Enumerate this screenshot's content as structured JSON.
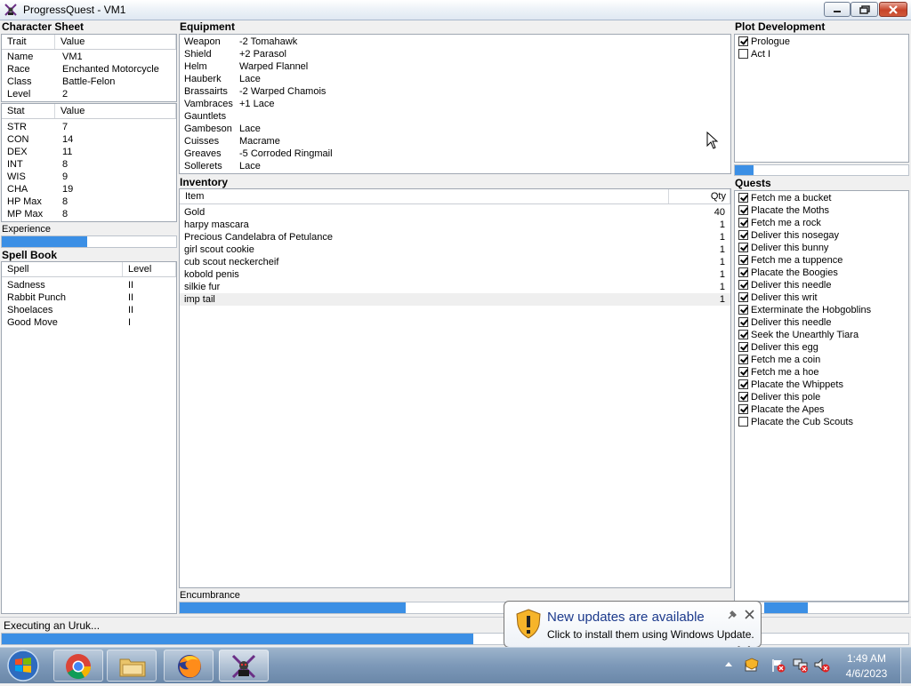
{
  "window": {
    "title": "ProgressQuest - VM1"
  },
  "character_sheet": {
    "title": "Character Sheet",
    "columns": [
      "Trait",
      "Value"
    ],
    "traits": [
      {
        "k": "Name",
        "v": "VM1"
      },
      {
        "k": "Race",
        "v": "Enchanted Motorcycle"
      },
      {
        "k": "Class",
        "v": "Battle-Felon"
      },
      {
        "k": "Level",
        "v": "2"
      }
    ],
    "stat_columns": [
      "Stat",
      "Value"
    ],
    "stats": [
      {
        "k": "STR",
        "v": "7"
      },
      {
        "k": "CON",
        "v": "14"
      },
      {
        "k": "DEX",
        "v": "11"
      },
      {
        "k": "INT",
        "v": "8"
      },
      {
        "k": "WIS",
        "v": "9"
      },
      {
        "k": "CHA",
        "v": "19"
      },
      {
        "k": "HP Max",
        "v": "8"
      },
      {
        "k": "MP Max",
        "v": "8"
      }
    ],
    "experience_label": "Experience",
    "experience_progress": 0.49
  },
  "spell_book": {
    "title": "Spell Book",
    "columns": [
      "Spell",
      "Level"
    ],
    "spells": [
      {
        "name": "Sadness",
        "level": "II"
      },
      {
        "name": "Rabbit Punch",
        "level": "II"
      },
      {
        "name": "Shoelaces",
        "level": "II"
      },
      {
        "name": "Good Move",
        "level": "I"
      }
    ]
  },
  "equipment": {
    "title": "Equipment",
    "items": [
      {
        "slot": "Weapon",
        "item": "-2 Tomahawk"
      },
      {
        "slot": "Shield",
        "item": "+2 Parasol"
      },
      {
        "slot": "Helm",
        "item": "Warped Flannel"
      },
      {
        "slot": "Hauberk",
        "item": "Lace"
      },
      {
        "slot": "Brassairts",
        "item": "-2 Warped Chamois"
      },
      {
        "slot": "Vambraces",
        "item": "+1 Lace"
      },
      {
        "slot": "Gauntlets",
        "item": ""
      },
      {
        "slot": "Gambeson",
        "item": "Lace"
      },
      {
        "slot": "Cuisses",
        "item": "Macrame"
      },
      {
        "slot": "Greaves",
        "item": "-5 Corroded Ringmail"
      },
      {
        "slot": "Sollerets",
        "item": "Lace"
      }
    ]
  },
  "inventory": {
    "title": "Inventory",
    "columns": [
      "Item",
      "Qty"
    ],
    "items": [
      {
        "name": "Gold",
        "qty": "40"
      },
      {
        "name": "harpy mascara",
        "qty": "1"
      },
      {
        "name": "Precious Candelabra of Petulance",
        "qty": "1"
      },
      {
        "name": "girl scout cookie",
        "qty": "1"
      },
      {
        "name": "cub scout neckercheif",
        "qty": "1"
      },
      {
        "name": "kobold penis",
        "qty": "1"
      },
      {
        "name": "silkie fur",
        "qty": "1"
      },
      {
        "name": "imp tail",
        "qty": "1"
      }
    ],
    "encumbrance_label": "Encumbrance",
    "encumbrance_progress": 0.41
  },
  "plot": {
    "title": "Plot Development",
    "acts": [
      {
        "label": "Prologue",
        "checked": true
      },
      {
        "label": "Act I",
        "checked": false
      }
    ],
    "progress": 0.11
  },
  "quests": {
    "title": "Quests",
    "items": [
      {
        "label": "Fetch me a bucket",
        "checked": true
      },
      {
        "label": "Placate the Moths",
        "checked": true
      },
      {
        "label": "Fetch me a rock",
        "checked": true
      },
      {
        "label": "Deliver this nosegay",
        "checked": true
      },
      {
        "label": "Deliver this bunny",
        "checked": true
      },
      {
        "label": "Fetch me a tuppence",
        "checked": true
      },
      {
        "label": "Placate the Boogies",
        "checked": true
      },
      {
        "label": "Deliver this needle",
        "checked": true
      },
      {
        "label": "Deliver this writ",
        "checked": true
      },
      {
        "label": "Exterminate the Hobgoblins",
        "checked": true
      },
      {
        "label": "Deliver this needle",
        "checked": true
      },
      {
        "label": "Seek the Unearthly Tiara",
        "checked": true
      },
      {
        "label": "Deliver this egg",
        "checked": true
      },
      {
        "label": "Fetch me a coin",
        "checked": true
      },
      {
        "label": "Fetch me a hoe",
        "checked": true
      },
      {
        "label": "Placate the Whippets",
        "checked": true
      },
      {
        "label": "Deliver this pole",
        "checked": true
      },
      {
        "label": "Placate the Apes",
        "checked": true
      },
      {
        "label": "Placate the Cub Scouts",
        "checked": false
      }
    ]
  },
  "status": {
    "text": "Executing an Uruk...",
    "progress": 0.52
  },
  "notification": {
    "title": "New updates are available",
    "body": "Click to install them using Windows Update."
  },
  "clock": {
    "time": "1:49 AM",
    "date": "4/6/2023"
  },
  "colors": {
    "accent": "#3b8fe5",
    "taskbar": "#7c98b8"
  }
}
